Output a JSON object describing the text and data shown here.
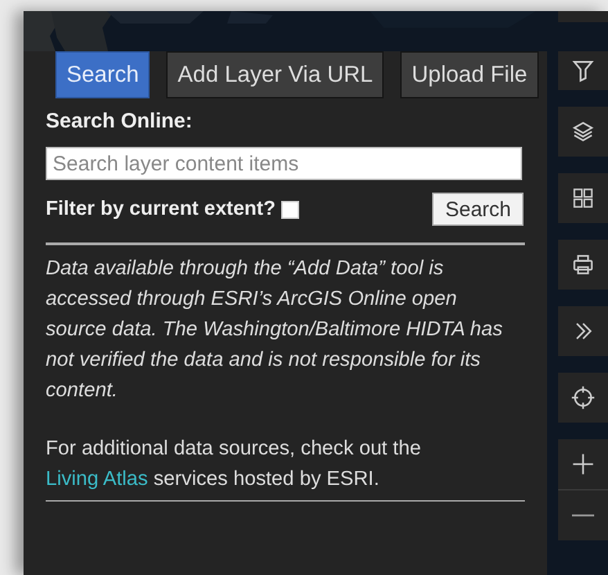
{
  "tabs": [
    {
      "label": "Search",
      "selected": true
    },
    {
      "label": "Add Layer Via URL",
      "selected": false
    },
    {
      "label": "Upload File",
      "selected": false
    }
  ],
  "search_online": {
    "label": "Search Online:",
    "placeholder": "Search layer content items"
  },
  "filter": {
    "label": "Filter by current extent?",
    "checked": false
  },
  "search_button": "Search",
  "disclaimer": "Data available through the “Add Data” tool is accessed through ESRI’s ArcGIS Online open source data. The Washington/Baltimore HIDTA has not verified the data and is not responsible for its content.",
  "more_info": {
    "text_before": "For additional data sources, check out the",
    "link": "Living Atlas",
    "text_after": "services hosted by ESRI."
  },
  "toolbar": [
    {
      "kind": "blank"
    },
    {
      "kind": "filter"
    },
    {
      "kind": "layers"
    },
    {
      "kind": "grid"
    },
    {
      "kind": "print"
    },
    {
      "kind": "expand"
    },
    {
      "kind": "locate"
    },
    {
      "kind": "zoom_in"
    },
    {
      "kind": "zoom_out"
    }
  ]
}
